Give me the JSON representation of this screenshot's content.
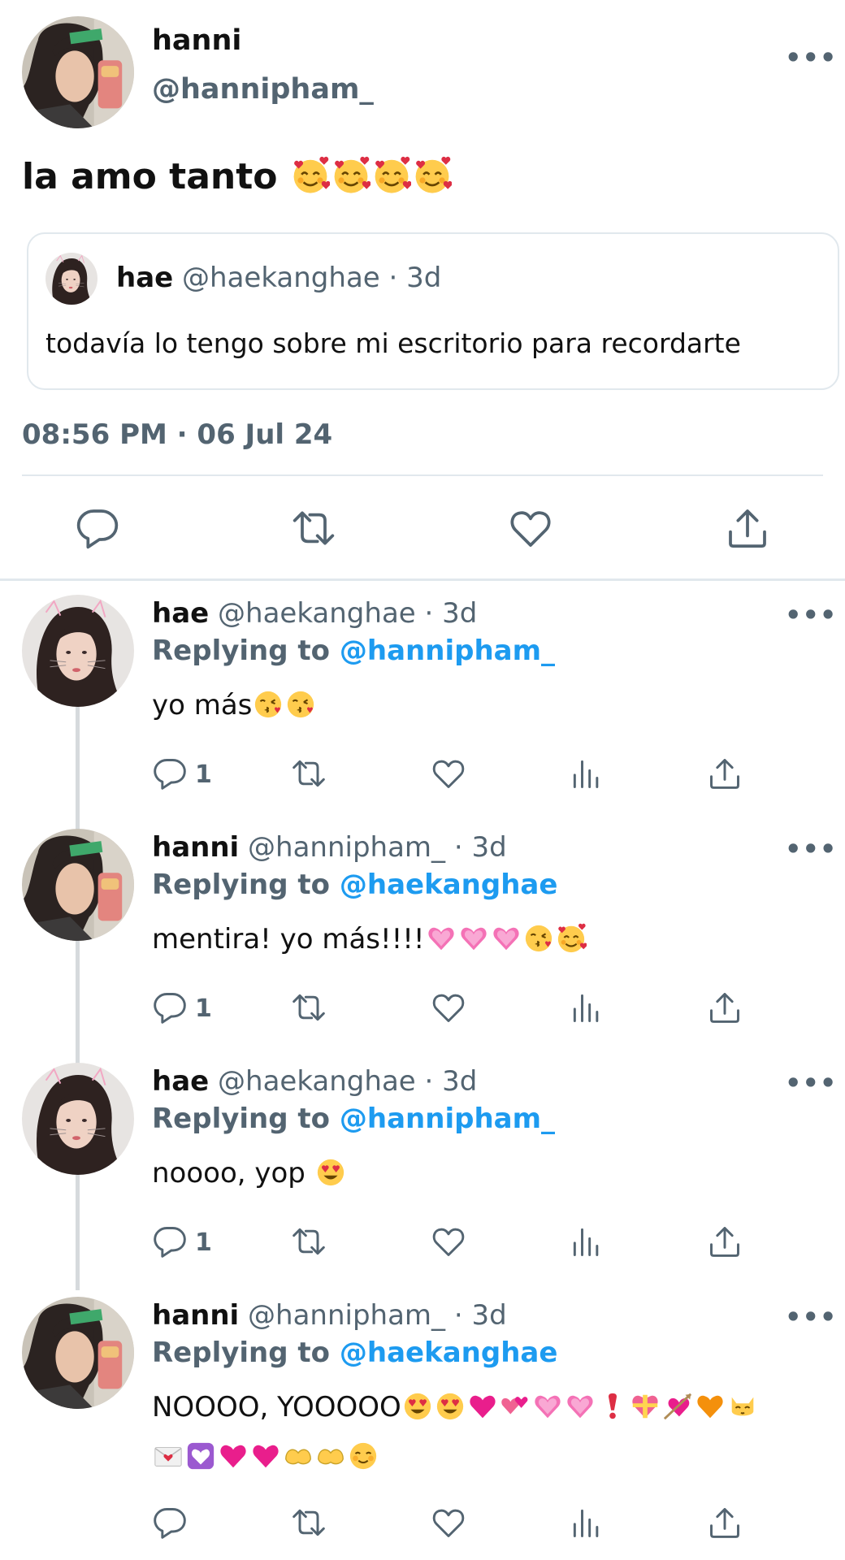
{
  "main_tweet": {
    "author_name": "hanni",
    "author_handle": "@hannipham_",
    "more_label": "•••",
    "text": "la amo tanto",
    "quoted": {
      "author_name": "hae",
      "author_meta": "@haekanghae · 3d",
      "text": "todavía lo tengo sobre mi escritorio para recordarte"
    },
    "timestamp": "08:56 PM · 06 Jul 24",
    "actions": [
      "reply-icon",
      "retweet-icon",
      "like-icon",
      "share-icon"
    ]
  },
  "replies": [
    {
      "author_name": "hae",
      "author_meta": "@haekanghae · 3d",
      "replying_label": "Replying to",
      "mention": "@hannipham_",
      "text": "yo más",
      "reply_count": "1",
      "more_label": "•••"
    },
    {
      "author_name": "hanni",
      "author_meta": "@hannipham_ · 3d",
      "replying_label": "Replying to",
      "mention": "@haekanghae",
      "text": "mentira! yo más!!!!",
      "reply_count": "1",
      "more_label": "•••"
    },
    {
      "author_name": "hae",
      "author_meta": "@haekanghae · 3d",
      "replying_label": "Replying to",
      "mention": "@hannipham_",
      "text": "noooo, yop",
      "reply_count": "1",
      "more_label": "•••"
    },
    {
      "author_name": "hanni",
      "author_meta": "@hannipham_ · 3d",
      "replying_label": "Replying to",
      "mention": "@haekanghae",
      "text": "NOOOO, YOOOOO",
      "reply_count": "",
      "more_label": "•••"
    }
  ],
  "colors": {
    "primary_text": "#111111",
    "secondary_text": "#536471",
    "link": "#1d9bf0",
    "divider": "#e1e8ed",
    "thread_line": "#d6dadd"
  }
}
